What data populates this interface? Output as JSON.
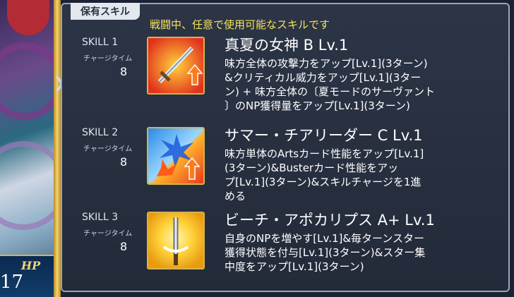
{
  "hp": {
    "label": "HP",
    "value": "17"
  },
  "panel": {
    "tab": "保有スキル",
    "subtitle": "戦闘中、任意で使用可能なスキルです"
  },
  "skills": [
    {
      "label": "SKILL 1",
      "charge_label": "チャージタイム",
      "charge_value": "8",
      "icon": "sword-up-icon",
      "name": "真夏の女神 B Lv.1",
      "desc_lines": [
        "味方全体の攻撃力をアップ[Lv.1](3ターン)",
        "&クリティカル威力をアップ[Lv.1](3ター",
        "ン) + 味方全体の〔夏モードのサーヴァント",
        "〕のNP獲得量をアップ[Lv.1](3ターン)"
      ]
    },
    {
      "label": "SKILL 2",
      "charge_label": "チャージタイム",
      "charge_value": "8",
      "icon": "arts-buster-up-icon",
      "name": "サマー・チアリーダー C Lv.1",
      "desc_lines": [
        "味方単体のArtsカード性能をアップ[Lv.1]",
        "(3ターン)&Busterカード性能をアッ",
        "プ[Lv.1](3ターン)&スキルチャージを1進",
        "める"
      ]
    },
    {
      "label": "SKILL 3",
      "charge_label": "チャージタイム",
      "charge_value": "8",
      "icon": "sword-glow-icon",
      "name": "ビーチ・アポカリプス A+ Lv.1",
      "desc_lines": [
        "自身のNPを増やす[Lv.1]&毎ターンスター",
        "獲得状態を付与[Lv.1](3ターン)&スター集",
        "中度をアップ[Lv.1](3ターン)"
      ]
    }
  ]
}
